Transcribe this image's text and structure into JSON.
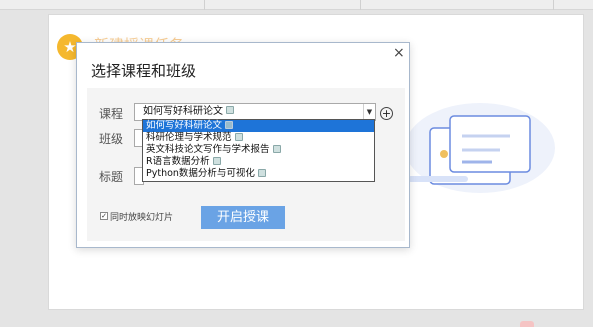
{
  "background": {
    "heading": "新建授课任务",
    "accent_color": "#f5b82e",
    "primary_color": "#6aa3e5"
  },
  "dialog": {
    "title": "选择课程和班级",
    "close_glyph": "×",
    "labels": {
      "course": "课程",
      "class": "班级",
      "topic": "标题"
    },
    "course_select": {
      "value": "如何写好科研论文"
    },
    "add_glyph": "+",
    "dropdown_options": [
      "如何写好科研论文",
      "科研伦理与学术规范",
      "英文科技论文写作与学术报告",
      "R语言数据分析",
      "Python数据分析与可视化"
    ],
    "selected_index": 0,
    "checkbox": {
      "label": "同时放映幻灯片",
      "checked": true,
      "mark": "✓"
    },
    "start_button": "开启授课"
  }
}
